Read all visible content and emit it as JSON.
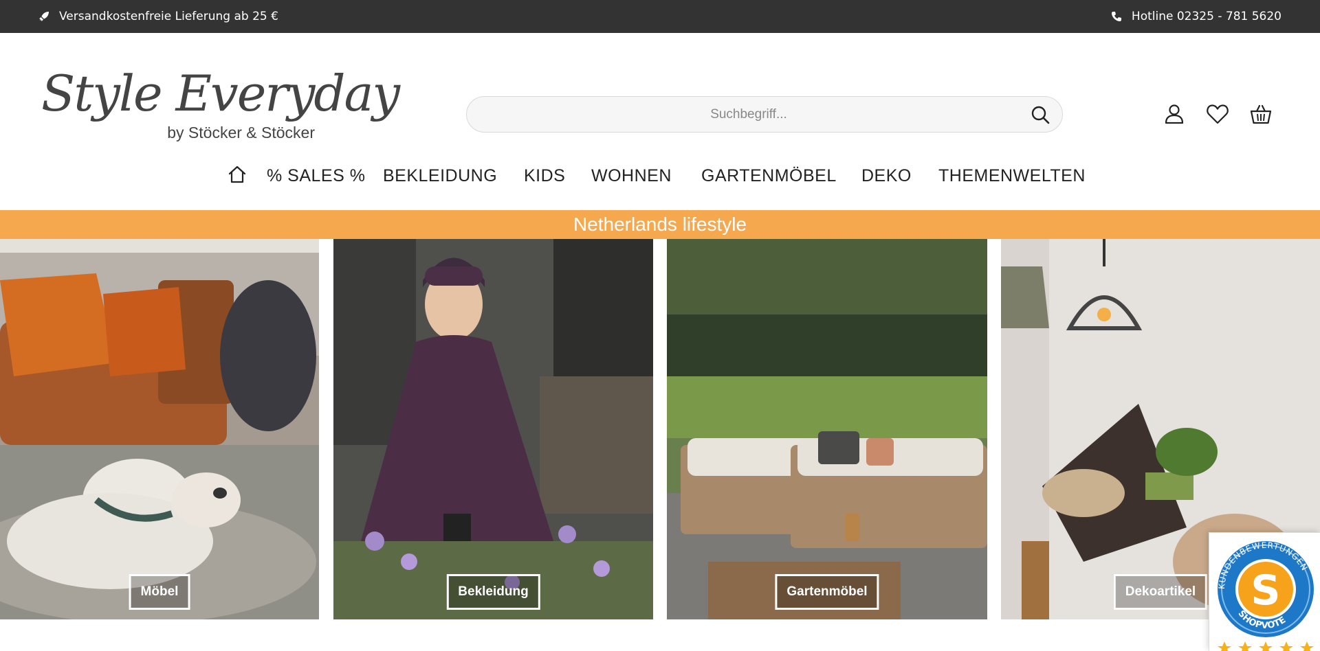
{
  "topbar": {
    "shipping_text": "Versandkostenfreie Lieferung ab 25 €",
    "hotline_text": "Hotline 02325 - 781 5620"
  },
  "header": {
    "logo_script": "Style Everyday",
    "logo_sub": "by Stöcker & Stöcker",
    "search_placeholder": "Suchbegriff...",
    "icons": [
      "user-icon",
      "heart-icon",
      "basket-icon"
    ]
  },
  "nav": {
    "items": [
      "% SALES %",
      "BEKLEIDUNG",
      "KIDS",
      "WOHNEN",
      "GARTENMÖBEL",
      "DEKO",
      "THEMENWELTEN"
    ]
  },
  "banner": {
    "text": "Netherlands lifestyle",
    "color": "#f5a84e"
  },
  "categories": [
    {
      "label": "Möbel"
    },
    {
      "label": "Bekleidung"
    },
    {
      "label": "Gartenmöbel"
    },
    {
      "label": "Dekoartikel"
    }
  ],
  "badge": {
    "ring_text": "KUNDENBEWERTUNGEN",
    "brand": "SHOPVOTE",
    "letter": "S"
  },
  "colors": {
    "topbar": "#333333",
    "accent": "#f5a84e",
    "badge_blue": "#1e78c8",
    "badge_orange": "#f7a21b"
  }
}
